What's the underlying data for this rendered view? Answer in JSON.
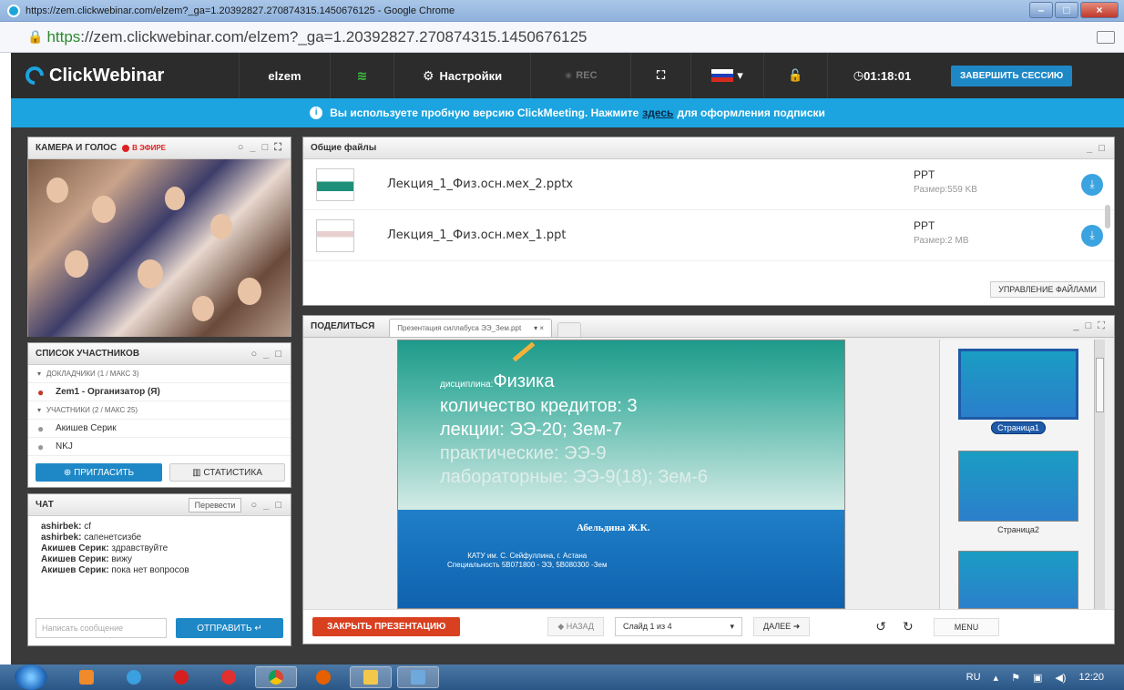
{
  "browser": {
    "window_title": "https://zem.clickwebinar.com/elzem?_ga=1.20392827.270874315.1450676125 - Google Chrome",
    "url_scheme": "https",
    "url_rest": "://zem.clickwebinar.com/elzem?_ga=1.20392827.270874315.1450676125"
  },
  "header": {
    "brand": "ClickWebinar",
    "room": "elzem",
    "settings_label": "Настройки",
    "rec_label": "REC",
    "timer": "01:18:01",
    "end_session_label": "ЗАВЕРШИТЬ СЕССИЮ"
  },
  "notice": {
    "before": "Вы используете пробную версию ClickMeeting. Нажмите",
    "link": "здесь",
    "after": "для оформления подписки"
  },
  "camera": {
    "title": "КАМЕРА И ГОЛОС",
    "status": "В ЭФИРЕ"
  },
  "participants": {
    "title": "СПИСОК УЧАСТНИКОВ",
    "groups": [
      {
        "label": "ДОКЛАДЧИКИ (1 / МАКС 3)",
        "members": [
          "Zem1 - Организатор (Я)"
        ]
      },
      {
        "label": "УЧАСТНИКИ (2 / МАКС 25)",
        "members": [
          "Акишев Серик",
          "NKJ"
        ]
      }
    ],
    "invite_label": "ПРИГЛАСИТЬ",
    "stats_label": "СТАТИСТИКА"
  },
  "chat": {
    "title": "ЧАТ",
    "translate_label": "Перевести",
    "messages": [
      {
        "author": "ashirbek:",
        "text": "cf"
      },
      {
        "author": "ashirbek:",
        "text": "сапенетсизбе"
      },
      {
        "author": "Акишев Серик:",
        "text": "здравствуйте"
      },
      {
        "author": "Акишев Серик:",
        "text": "вижу"
      },
      {
        "author": "Акишев Серик:",
        "text": "пока нет вопросов"
      }
    ],
    "input_placeholder": "Написать сообщение",
    "send_label": "ОТПРАВИТЬ"
  },
  "files": {
    "title": "Общие файлы",
    "items": [
      {
        "name": "Лекция_1_Физ.осн.мех_2.pptx",
        "type": "PPT",
        "size": "Размер:559 KB"
      },
      {
        "name": "Лекция_1_Физ.осн.мех_1.ppt",
        "type": "PPT",
        "size": "Размер:2 MB"
      }
    ],
    "manage_label": "УПРАВЛЕНИЕ ФАЙЛАМИ"
  },
  "share": {
    "title": "ПОДЕЛИТЬСЯ",
    "tab_label": "Презентация силлабуса ЭЭ_Зем.ppt",
    "slide": {
      "discipline_small": "дисциплина:",
      "discipline": "Физика",
      "lines": [
        "количество кредитов: 3",
        "лекции: ЭЭ-20; Зем-7",
        "практические: ЭЭ-9",
        "лабораторные: ЭЭ-9(18); Зем-6"
      ],
      "author": "Абельдина Ж.К.",
      "institution": "КАТУ им. С. Сейфуллина, г. Астана",
      "specialty": "Специальность 5B071800 - ЭЭ, 5B080300 -Зем"
    },
    "pages": [
      "Страница1",
      "Страница2"
    ],
    "close_label": "ЗАКРЫТЬ ПРЕЗЕНТАЦИЮ",
    "prev_label": "НАЗАД",
    "slide_select": "Слайд 1 из 4",
    "next_label": "ДАЛЕЕ",
    "menu_label": "MENU"
  },
  "taskbar": {
    "lang": "RU",
    "clock": "12:20"
  },
  "colors": {
    "accent": "#1ba4e0",
    "header_bg": "#2c2c2c",
    "close_red": "#d9401f",
    "button_blue": "#1e88c7"
  }
}
